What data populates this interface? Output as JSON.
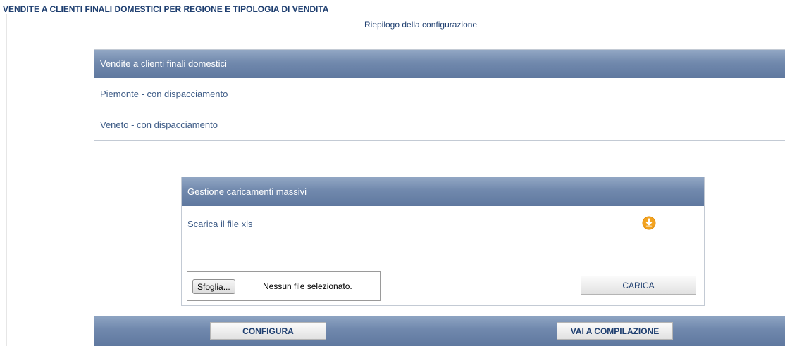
{
  "page": {
    "title": "VENDITE A CLIENTI FINALI DOMESTICI PER REGIONE E TIPOLOGIA DI VENDITA",
    "subtitle": "Riepilogo della configurazione"
  },
  "summary": {
    "header": "Vendite a clienti finali domestici",
    "items": [
      "Piemonte - con dispacciamento",
      "Veneto - con dispacciamento"
    ]
  },
  "upload": {
    "header": "Gestione caricamenti massivi",
    "download_label": "Scarica il file xls",
    "download_icon": "download-icon",
    "browse_label": "Sfoglia...",
    "file_status": "Nessun file selezionato.",
    "upload_button": "CARICA"
  },
  "actions": {
    "configure": "CONFIGURA",
    "compile": "VAI A COMPILAZIONE"
  },
  "colors": {
    "title_text": "#1f3f70",
    "link_text": "#3d5b86",
    "header_bar": "#7088ad",
    "download_icon": "#f2a21f"
  }
}
